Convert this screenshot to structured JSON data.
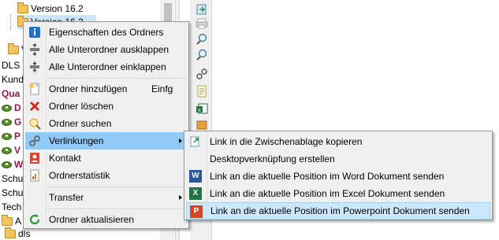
{
  "tree": {
    "rows": [
      {
        "label": "Version 16.2",
        "icon": "folder"
      },
      {
        "label": "Version 16.2",
        "icon": "folder"
      },
      {
        "label": "V",
        "icon": "folder"
      },
      {
        "label": "DLS",
        "icon": "none"
      },
      {
        "label": "Kund",
        "icon": "none"
      },
      {
        "label": "Qua",
        "icon": "none"
      },
      {
        "label": "D",
        "icon": "eye"
      },
      {
        "label": "G",
        "icon": "eye"
      },
      {
        "label": "P",
        "icon": "eye"
      },
      {
        "label": "V",
        "icon": "eye"
      },
      {
        "label": "W",
        "icon": "eye"
      },
      {
        "label": "Schu",
        "icon": "none"
      },
      {
        "label": "Schu",
        "icon": "none"
      },
      {
        "label": "Tech",
        "icon": "none"
      },
      {
        "label": "A",
        "icon": "folder"
      },
      {
        "label": "dls",
        "icon": "folder"
      }
    ],
    "quality_color": "#8b1a4a"
  },
  "context_menu": {
    "items": [
      {
        "label": "Eigenschaften des Ordners",
        "icon": "info-icon",
        "shortcut": "",
        "submenu": false
      },
      {
        "label": "Alle Unterordner ausklappen",
        "icon": "expand-all-icon",
        "shortcut": "",
        "submenu": false
      },
      {
        "label": "Alle Unterordner einklappen",
        "icon": "collapse-all-icon",
        "shortcut": "",
        "submenu": false
      },
      {
        "label": "Ordner hinzufügen",
        "icon": "new-folder-icon",
        "shortcut": "Einfg",
        "submenu": false
      },
      {
        "label": "Ordner löschen",
        "icon": "delete-icon",
        "shortcut": "",
        "submenu": false
      },
      {
        "label": "Ordner suchen",
        "icon": "search-folder-icon",
        "shortcut": "",
        "submenu": false
      },
      {
        "label": "Verlinkungen",
        "icon": "link-icon",
        "shortcut": "",
        "submenu": true,
        "highlighted": true
      },
      {
        "label": "Kontakt",
        "icon": "contact-icon",
        "shortcut": "",
        "submenu": false
      },
      {
        "label": "Ordnerstatistik",
        "icon": "statistics-icon",
        "shortcut": "",
        "submenu": false
      },
      {
        "label": "Transfer",
        "icon": "none",
        "shortcut": "",
        "submenu": true
      },
      {
        "label": "Ordner aktualisieren",
        "icon": "refresh-icon",
        "shortcut": "",
        "submenu": false
      }
    ]
  },
  "submenu": {
    "items": [
      {
        "label": "Link in die Zwischenablage kopieren",
        "icon": "clipboard-link-icon"
      },
      {
        "label": "Desktopverknüpfung erstellen",
        "icon": "none"
      },
      {
        "label": "Link an die aktuelle Position im Word Dokument senden",
        "icon": "word-icon",
        "badge": "W"
      },
      {
        "label": "Link an die aktuelle Position im Excel Dokument senden",
        "icon": "excel-icon",
        "badge": "X"
      },
      {
        "label": "Link an die aktuelle Position im Powerpoint Dokument senden",
        "icon": "powerpoint-icon",
        "badge": "P",
        "highlighted": true
      }
    ]
  },
  "colors": {
    "menu_bg": "#f0f0f0",
    "highlight": "#91c9f7",
    "submenu_highlight": "#cce8ff",
    "word": "#2b579a",
    "excel": "#217346",
    "powerpoint": "#d24726"
  }
}
